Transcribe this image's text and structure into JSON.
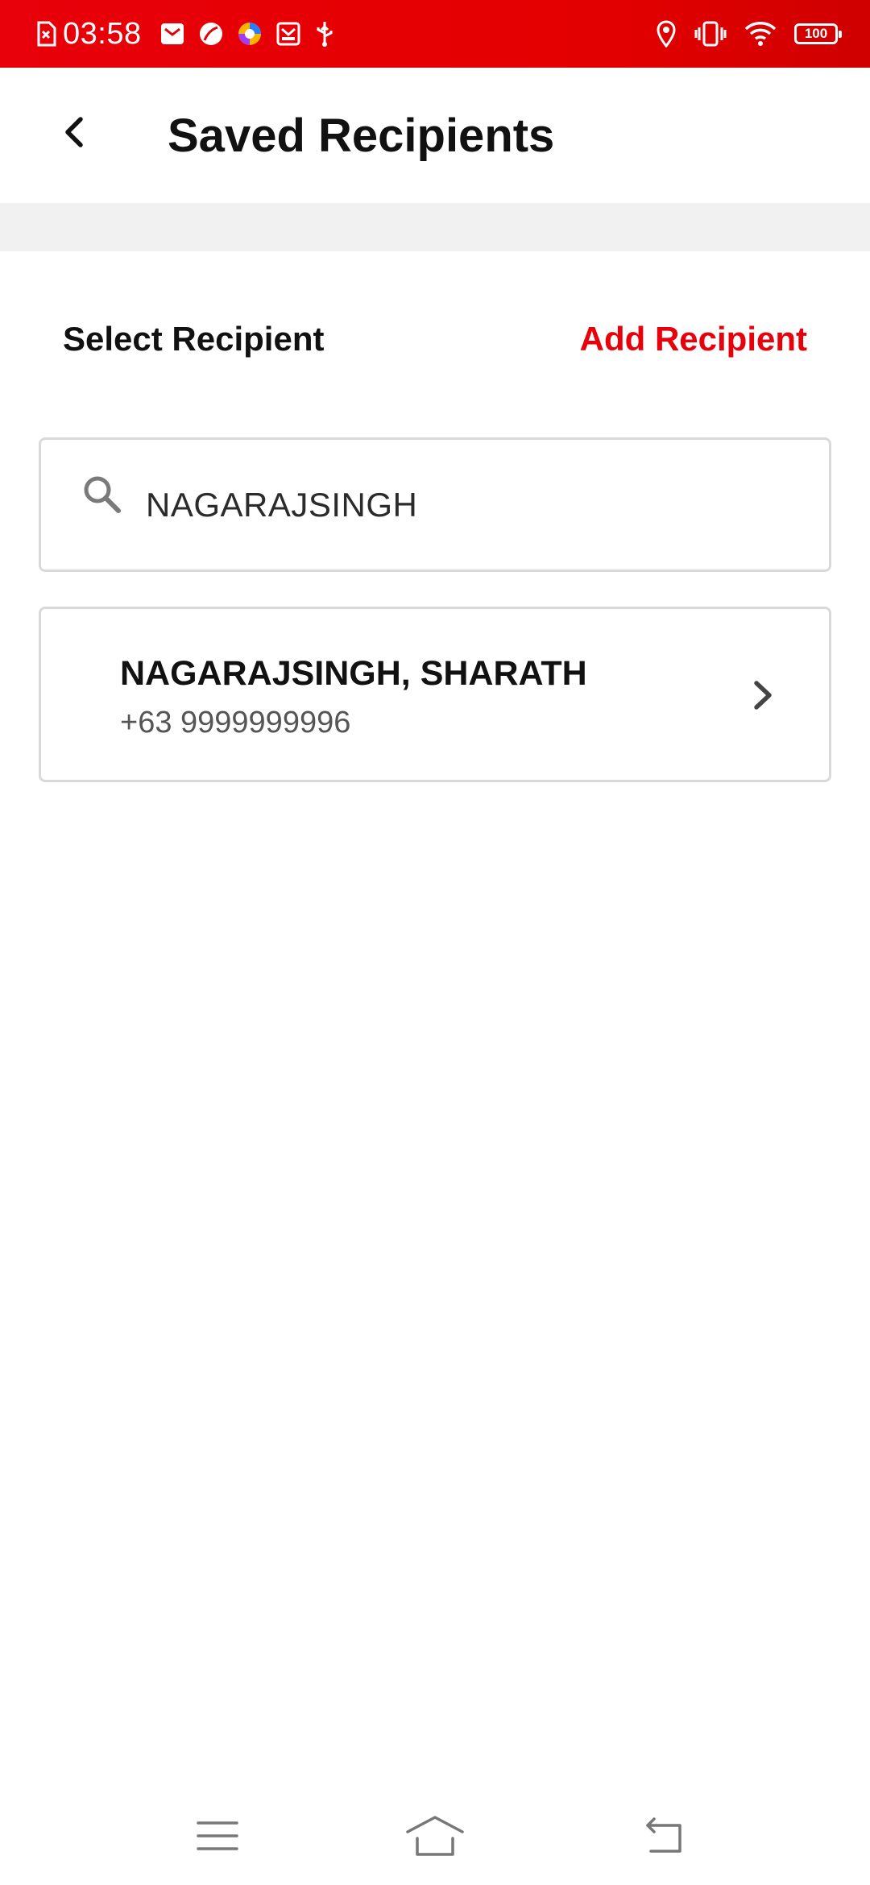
{
  "status_bar": {
    "time": "03:58",
    "battery": "100",
    "left_icons": [
      "sim-error-icon",
      "mail-icon",
      "leaf-icon",
      "browser-icon",
      "inbox-icon",
      "usb-icon"
    ],
    "right_icons": [
      "location-icon",
      "vibrate-icon",
      "wifi-icon",
      "battery-icon"
    ],
    "color": "#e8000a"
  },
  "header": {
    "title": "Saved Recipients",
    "back_icon": "back-arrow-icon"
  },
  "section": {
    "label": "Select Recipient",
    "add_label": "Add Recipient",
    "accent_color": "#e8000a"
  },
  "search": {
    "value": "NAGARAJSINGH",
    "icon": "search-icon"
  },
  "recipients": [
    {
      "name": "NAGARAJSINGH, SHARATH",
      "phone": "+63 9999999996",
      "icon": "chevron-right-icon"
    }
  ],
  "nav_bar": {
    "icons": [
      "menu-icon",
      "home-icon",
      "back-icon"
    ]
  }
}
